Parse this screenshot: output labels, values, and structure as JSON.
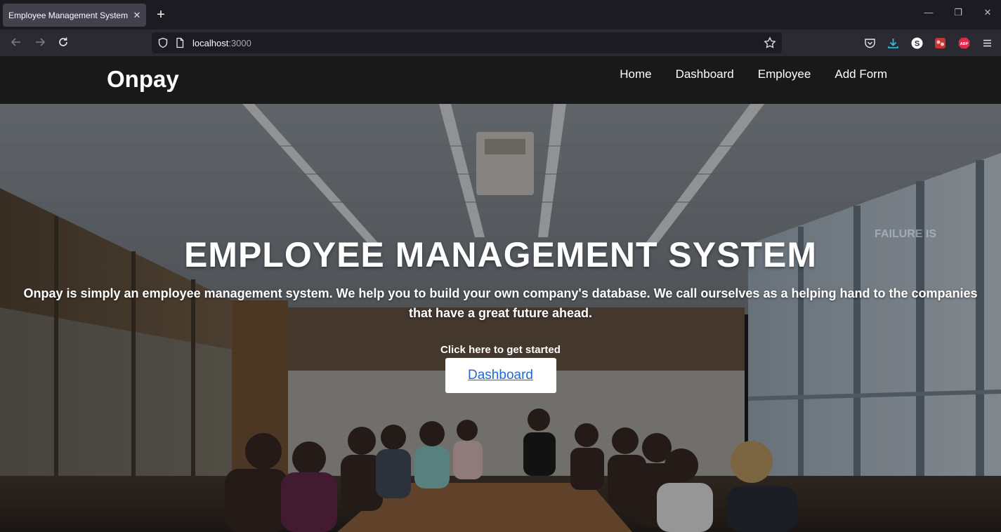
{
  "browser": {
    "tab_title": "Employee Management System",
    "tab_close": "✕",
    "new_tab": "+",
    "url_host": "localhost",
    "url_port": ":3000",
    "window_controls": [
      "—",
      "❐",
      "✕"
    ]
  },
  "site": {
    "brand": "Onpay",
    "nav": [
      "Home",
      "Dashboard",
      "Employee",
      "Add Form"
    ]
  },
  "hero": {
    "title": "EMPLOYEE MANAGEMENT SYSTEM",
    "description": "Onpay is simply an employee management system. We help you to build your own company's database. We call ourselves as a helping hand to the companies that have a great future ahead.",
    "cta_label": "Click here to get started",
    "cta_button": "Dashboard",
    "window_text": "FAILURE IS"
  },
  "colors": {
    "chrome_bg": "#1c1b22",
    "toolbar_bg": "#2b2a33",
    "header_bg": "#191919",
    "link_blue": "#2168d3"
  }
}
